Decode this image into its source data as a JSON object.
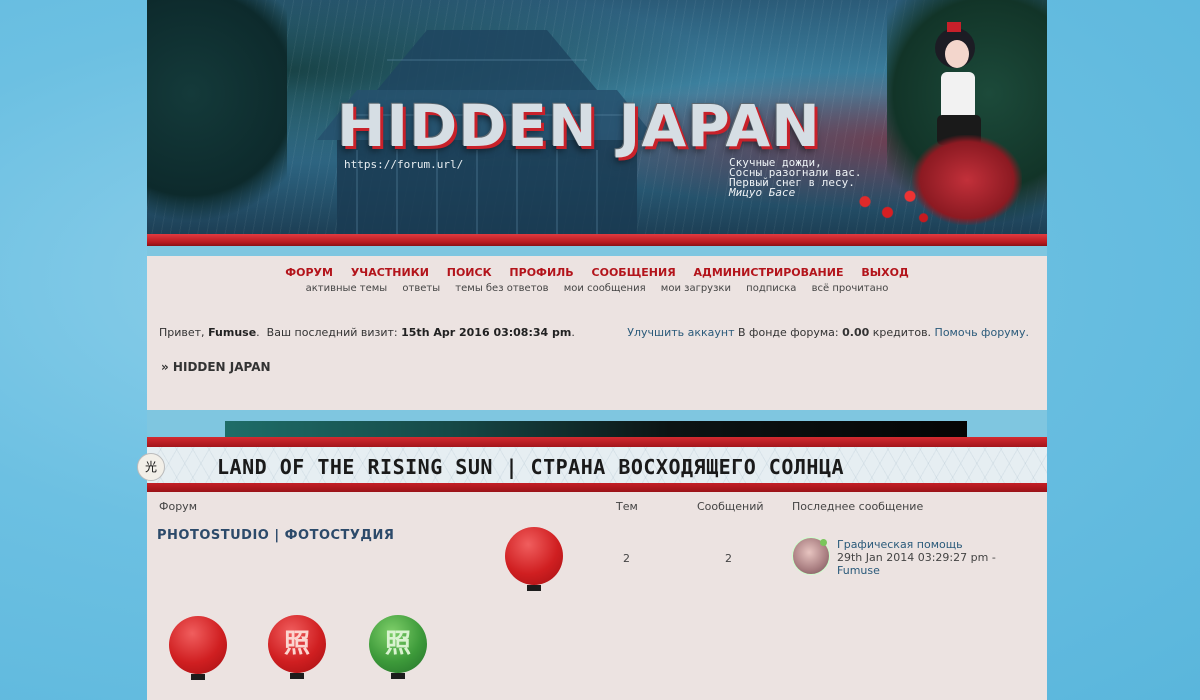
{
  "banner": {
    "title": "HIDDEN JAPAN",
    "url": "https://forum.url/",
    "poem": [
      "Скучные дожди,",
      "Сосны разогнали вас.",
      "Первый снег в лесу."
    ],
    "poem_author": "Мицуо Басе"
  },
  "nav": {
    "main": [
      "ФОРУМ",
      "УЧАСТНИКИ",
      "ПОИСК",
      "ПРОФИЛЬ",
      "СООБЩЕНИЯ",
      "АДМИНИСТРИРОВАНИЕ",
      "ВЫХОД"
    ],
    "sub": [
      "активные темы",
      "ответы",
      "темы без ответов",
      "мои сообщения",
      "мои загрузки",
      "подписка",
      "всё прочитано"
    ]
  },
  "welcome": {
    "greeting": "Привет,",
    "username": "Fumuse",
    "visit_label": "Ваш последний визит:",
    "visit_time": "15th Apr 2016 03:08:34 pm"
  },
  "account": {
    "upgrade": "Улучшить аккаунт",
    "fund_label": "В фонде форума:",
    "fund_value": "0.00",
    "fund_unit": "кредитов.",
    "help": "Помочь форуму."
  },
  "breadcrumb": "» HIDDEN JAPAN",
  "category": {
    "badge": "光",
    "title": "LAND OF THE RISING SUN | СТРАНА ВОСХОДЯЩЕГО СОЛНЦА"
  },
  "table": {
    "headers": {
      "forum": "Форум",
      "topics": "Тем",
      "posts": "Сообщений",
      "last": "Последнее сообщение"
    },
    "rows": [
      {
        "name": "PHOTOSTUDIO | ФОТОСТУДИЯ",
        "topics": "2",
        "posts": "2",
        "last_title": "Графическая помощь",
        "last_date": "29th Jan 2014 03:29:27 pm -",
        "last_user": "Fumuse"
      }
    ]
  },
  "lanterns": [
    {
      "color": "red",
      "glyph": ""
    },
    {
      "color": "red",
      "glyph": ""
    },
    {
      "color": "red",
      "glyph": "照"
    },
    {
      "color": "green",
      "glyph": "照"
    }
  ],
  "colors": {
    "accent_red": "#b3141b",
    "background_blue": "#6cc0e2",
    "panel": "#ece3e1",
    "link": "#2a5a7a"
  }
}
